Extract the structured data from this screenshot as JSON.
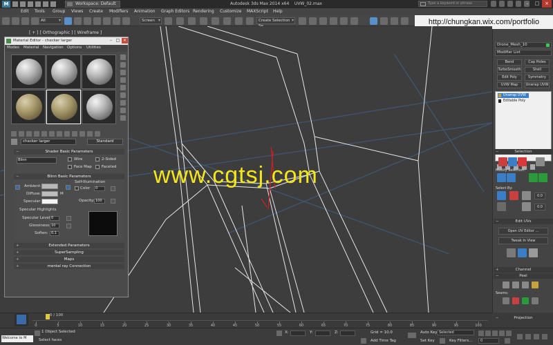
{
  "titlebar": {
    "workspace": "Workspace: Default",
    "app_title": "Autodesk 3ds Max  2014 x64",
    "file_name": "UVW_02.max",
    "search_placeholder": "Type a keyword or phrase"
  },
  "menu": [
    "Edit",
    "Tools",
    "Group",
    "Views",
    "Create",
    "Modifiers",
    "Animation",
    "Graph Editors",
    "Rendering",
    "Customize",
    "MAXScript",
    "Help"
  ],
  "toolbar": {
    "selection_filter": "All",
    "ref_coord": "Screen",
    "named_selection": "Create Selection Se"
  },
  "url_banner": "http://chungkan.wix.com/portfolio",
  "viewport": {
    "label_plus": "[ + ]",
    "label_view": "[ Orthographic ]",
    "label_shading": "[ Wireframe ]",
    "watermark": "www.cgtsj.com"
  },
  "material_editor": {
    "title": "Material Editor - checker larger",
    "menus": [
      "Modes",
      "Material",
      "Navigation",
      "Options",
      "Utilities"
    ],
    "material_name": "checker larger",
    "material_type": "Standard",
    "shader_rollout": "Shader Basic Parameters",
    "shader": "Blinn",
    "shader_options": [
      "Wire",
      "2-Sided",
      "Face Map",
      "Faceted"
    ],
    "blinn_rollout": "Blinn Basic Parameters",
    "self_illum_label": "Self-Illumination",
    "color_label": "Color",
    "color_value": "0",
    "ambient_label": "Ambient:",
    "diffuse_label": "Diffuse:",
    "specular_label": "Specular:",
    "lock_label": "M",
    "opacity_label": "Opacity:",
    "opacity_value": "100",
    "spec_highlights_label": "Specular Highlights",
    "spec_level_label": "Specular Level:",
    "spec_level_value": "0",
    "glossiness_label": "Glossiness:",
    "glossiness_value": "10",
    "soften_label": "Soften:",
    "soften_value": "0.1",
    "collapsed_rollouts": [
      "Extended Parameters",
      "SuperSampling",
      "Maps",
      "mental ray Connection"
    ]
  },
  "command_panel": {
    "object_name": "Drone_Mesh_10",
    "modifier_list": "Modifier List",
    "modifier_buttons": [
      "Bend",
      "Cap Holes",
      "TurboSmooth",
      "Shell",
      "Edit Poly",
      "Symmetry",
      "UVW Map",
      "Unwrap UVW"
    ],
    "stack": [
      "Unwrap UVW",
      "Editable Poly"
    ],
    "selection_rollout": "Selection",
    "modify_selection": "Modify Selection:",
    "select_by": "Select By:",
    "spinner_value": "0.0",
    "spinner2_value": "0.0",
    "edit_uvs_rollout": "Edit UVs",
    "open_uv_editor": "Open UV Editor ...",
    "tweak_in_view": "Tweak In View",
    "channel_rollout": "Channel",
    "peel_rollout": "Peel",
    "seams_label": "Seams:",
    "projection_rollout": "Projection"
  },
  "timeline": {
    "slider_label": "0 / 100",
    "ticks": [
      "0",
      "5",
      "10",
      "15",
      "20",
      "25",
      "30",
      "35",
      "40",
      "45",
      "50",
      "55",
      "60",
      "65",
      "70",
      "75",
      "80",
      "85",
      "90",
      "95",
      "100"
    ]
  },
  "status": {
    "maxscript": "Welcome to M",
    "selected": "1 Object Selected",
    "prompt": "Select faces",
    "x_label": "X:",
    "y_label": "Y:",
    "z_label": "Z:",
    "grid": "Grid = 10.0",
    "add_time_tag": "Add Time Tag",
    "auto_key": "Auto Key",
    "set_key": "Set Key",
    "key_mode": "Selected",
    "key_filters": "Key Filters...",
    "frame": "0"
  }
}
